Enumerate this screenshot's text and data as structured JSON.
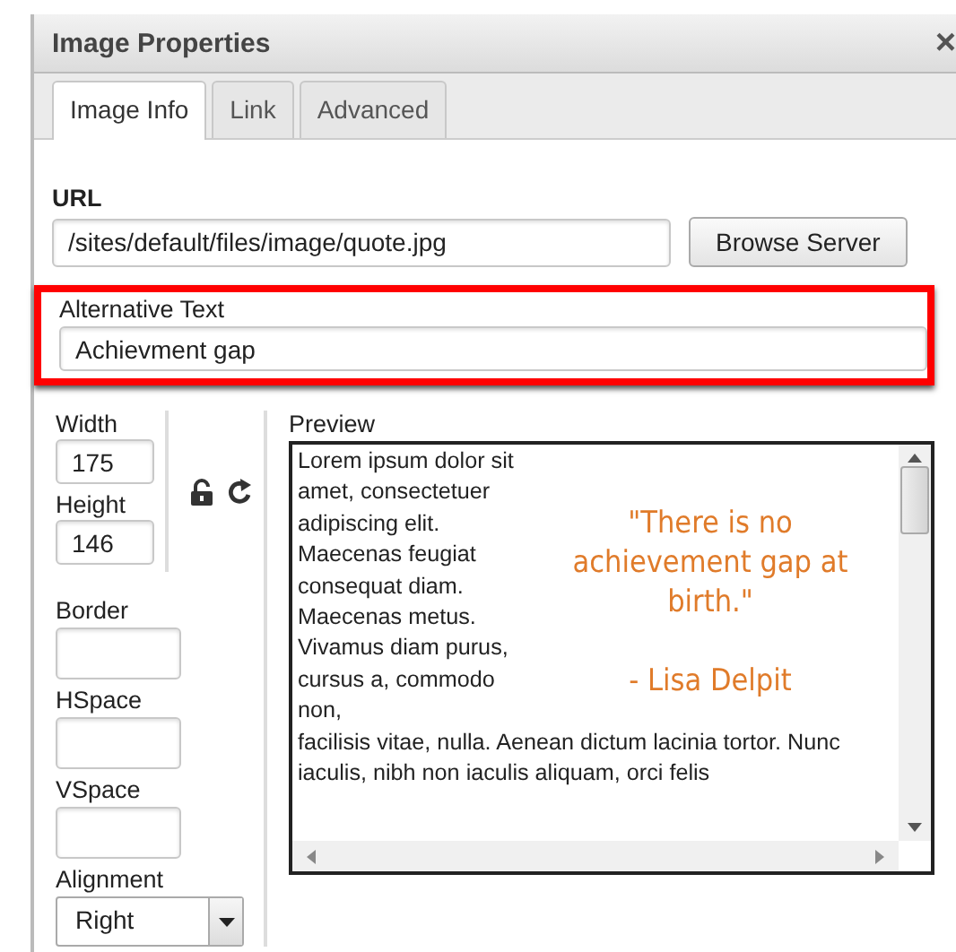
{
  "dialog": {
    "title": "Image Properties",
    "close": "×"
  },
  "tabs": [
    {
      "label": "Image Info",
      "selected": true
    },
    {
      "label": "Link",
      "selected": false
    },
    {
      "label": "Advanced",
      "selected": false
    }
  ],
  "url": {
    "label": "URL",
    "value": "/sites/default/files/image/quote.jpg"
  },
  "browse_button": "Browse Server",
  "alt_text": {
    "label": "Alternative Text",
    "value": "Achievment gap",
    "highlighted": true
  },
  "size_fields": [
    {
      "label": "Width",
      "value": "175"
    },
    {
      "label": "Height",
      "value": "146"
    }
  ],
  "spacing_fields": [
    {
      "label": "Border"
    },
    {
      "label": "HSpace"
    },
    {
      "label": "VSpace"
    }
  ],
  "alignment": {
    "label": "Alignment",
    "value": "Right"
  },
  "preview": {
    "label": "Preview",
    "text_beside": "Lorem ipsum dolor sit amet, consectetuer adipiscing elit. Maecenas feugiat consequat diam. Maecenas metus. Vivamus diam purus, cursus a, commodo non,",
    "text_below": "facilisis vitae, nulla. Aenean dictum lacinia tortor. Nunc iaculis, nibh non iaculis aliquam, orci felis",
    "quote": "\"There is no achievement gap at birth.\"",
    "author": "- Lisa Delpit"
  }
}
